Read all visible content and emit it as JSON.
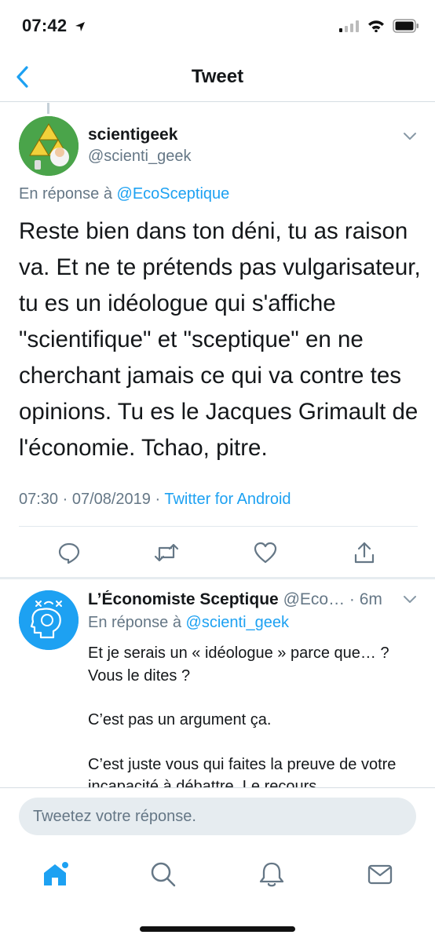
{
  "status_bar": {
    "time": "07:42"
  },
  "nav": {
    "title": "Tweet"
  },
  "main_tweet": {
    "name": "scientigeek",
    "handle": "@scienti_geek",
    "reply_prefix": "En réponse à ",
    "reply_to": "@EcoSceptique",
    "text": "Reste bien dans ton déni, tu as raison va. Et ne te prétends pas vulgarisateur, tu es un idéologue qui s'affiche \"scientifique\" et \"sceptique\" en ne cherchant jamais ce qui va contre tes opinions. Tu es le Jacques Grimault de l'économie. Tchao, pitre.",
    "meta_time": "07:30 · 07/08/2019 · ",
    "meta_source": "Twitter for Android"
  },
  "reply_tweet": {
    "name": "L’Économiste Sceptique",
    "handle": " @Eco…",
    "age": " · 6m",
    "reply_prefix": "En réponse à ",
    "reply_to": "@scienti_geek",
    "paragraphs": [
      "Et je serais un « idéologue » parce que… ? Vous le dites ?",
      "C’est pas un argument ça.",
      "C’est juste vous qui faites la preuve de votre incapacité à débattre. Le recours"
    ]
  },
  "composer": {
    "placeholder": "Tweetez votre réponse."
  },
  "colors": {
    "accent": "#1da1f2",
    "secondary_text": "#657786"
  },
  "icons": [
    "back-icon",
    "chevron-down-icon",
    "reply-icon",
    "retweet-icon",
    "like-icon",
    "share-icon",
    "home-icon",
    "search-icon",
    "notifications-icon",
    "messages-icon"
  ]
}
